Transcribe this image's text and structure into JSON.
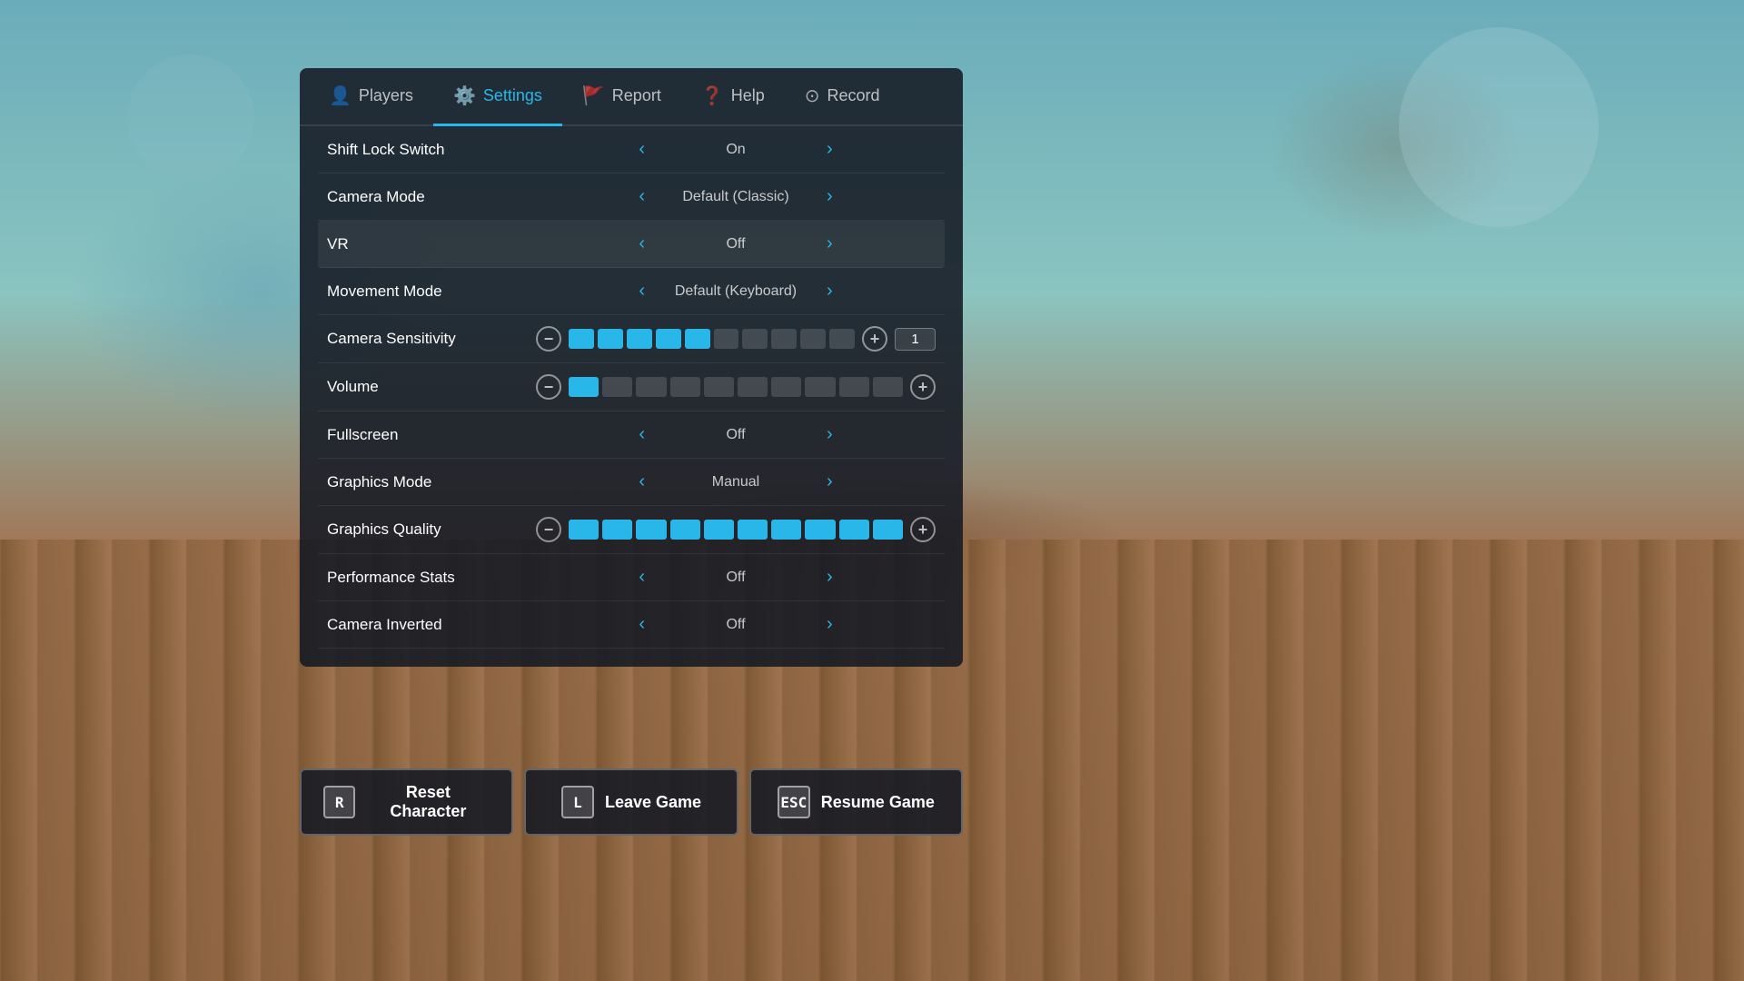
{
  "background": {
    "color": "#5a8a9a"
  },
  "tabs": [
    {
      "id": "players",
      "label": "Players",
      "icon": "👤",
      "active": false
    },
    {
      "id": "settings",
      "label": "Settings",
      "icon": "⚙️",
      "active": true
    },
    {
      "id": "report",
      "label": "Report",
      "icon": "🚩",
      "active": false
    },
    {
      "id": "help",
      "label": "Help",
      "icon": "❓",
      "active": false
    },
    {
      "id": "record",
      "label": "Record",
      "icon": "⊙",
      "active": false
    }
  ],
  "settings": [
    {
      "id": "shift-lock",
      "label": "Shift Lock Switch",
      "type": "toggle",
      "value": "On"
    },
    {
      "id": "camera-mode",
      "label": "Camera Mode",
      "type": "toggle",
      "value": "Default (Classic)"
    },
    {
      "id": "vr",
      "label": "VR",
      "type": "toggle",
      "value": "Off",
      "highlighted": true
    },
    {
      "id": "movement-mode",
      "label": "Movement Mode",
      "type": "toggle",
      "value": "Default (Keyboard)"
    },
    {
      "id": "camera-sensitivity",
      "label": "Camera Sensitivity",
      "type": "slider",
      "segments": 10,
      "filled": 5,
      "numValue": "1"
    },
    {
      "id": "volume",
      "label": "Volume",
      "type": "slider",
      "segments": 10,
      "filled": 1
    },
    {
      "id": "fullscreen",
      "label": "Fullscreen",
      "type": "toggle",
      "value": "Off"
    },
    {
      "id": "graphics-mode",
      "label": "Graphics Mode",
      "type": "toggle",
      "value": "Manual"
    },
    {
      "id": "graphics-quality",
      "label": "Graphics Quality",
      "type": "slider",
      "segments": 10,
      "filled": 10
    },
    {
      "id": "performance-stats",
      "label": "Performance Stats",
      "type": "toggle",
      "value": "Off"
    },
    {
      "id": "camera-inverted",
      "label": "Camera Inverted",
      "type": "toggle",
      "value": "Off"
    }
  ],
  "buttons": [
    {
      "id": "reset",
      "key": "R",
      "label": "Reset Character"
    },
    {
      "id": "leave",
      "key": "L",
      "label": "Leave Game"
    },
    {
      "id": "resume",
      "key": "ESC",
      "label": "Resume Game"
    }
  ],
  "accent_color": "#29b6e8"
}
